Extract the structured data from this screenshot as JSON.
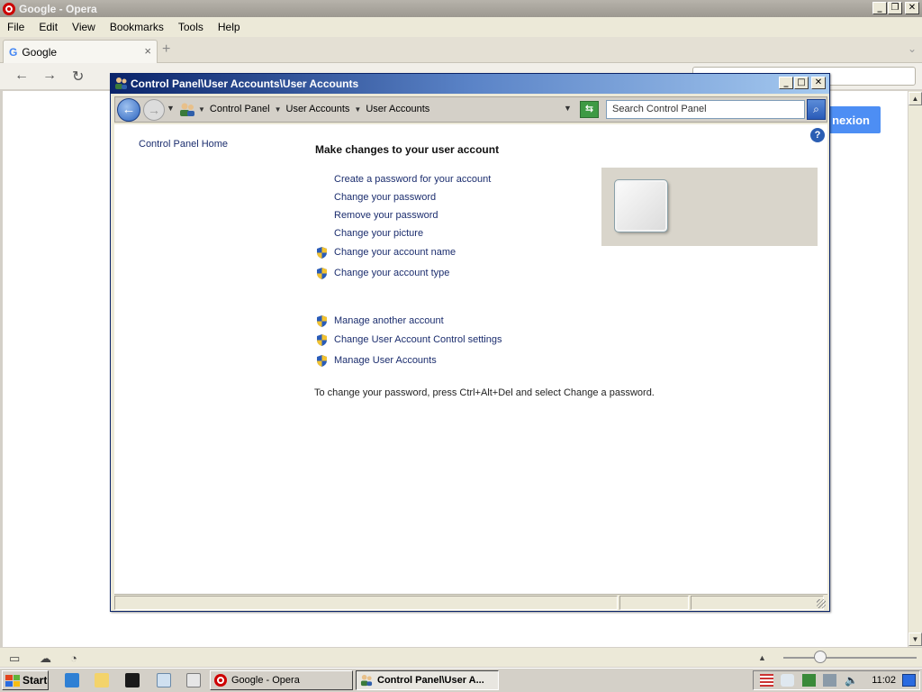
{
  "opera": {
    "title": "Google - Opera",
    "menu": [
      "File",
      "Edit",
      "View",
      "Bookmarks",
      "Tools",
      "Help"
    ],
    "tab_label": "Google",
    "page_button": "nexion"
  },
  "cp": {
    "title": "Control Panel\\User Accounts\\User Accounts",
    "breadcrumb": [
      "Control Panel",
      "User Accounts",
      "User Accounts"
    ],
    "search_placeholder": "Search Control Panel",
    "home_link": "Control Panel Home",
    "heading": "Make changes to your user account",
    "links_plain": [
      "Create a password for your account",
      "Change your password",
      "Remove your password",
      "Change your picture"
    ],
    "links_shield": [
      "Change your account name",
      "Change your account type"
    ],
    "links_other": [
      "Manage another account",
      "Change User Account Control settings",
      "Manage User Accounts"
    ],
    "note": "To change your password, press Ctrl+Alt+Del and select Change a password."
  },
  "taskbar": {
    "start": "Start",
    "tasks": [
      "Google - Opera",
      "Control Panel\\User A..."
    ],
    "clock": "11:02"
  },
  "colors": {
    "accent": "#0a246a",
    "link": "#1b2d6e",
    "page_button": "#4d8ef4"
  }
}
